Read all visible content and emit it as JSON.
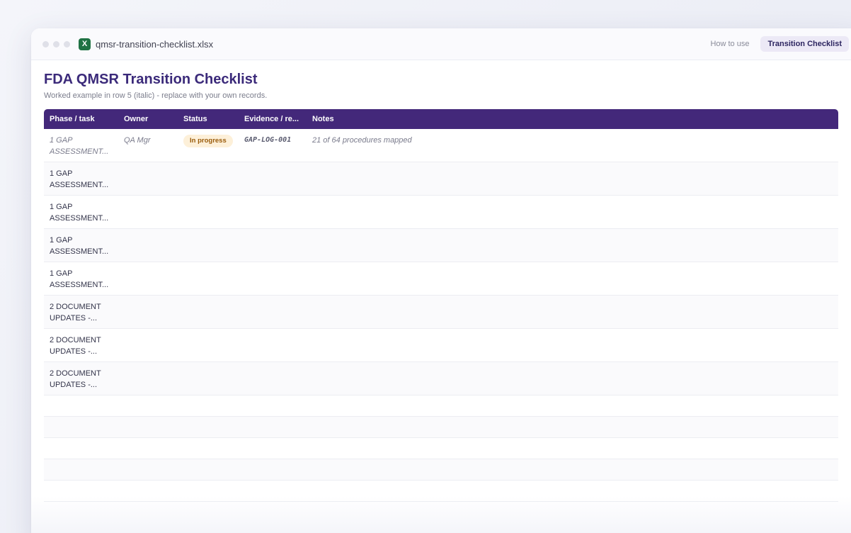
{
  "window": {
    "icon_letter": "X",
    "filename": "qmsr-transition-checklist.xlsx",
    "tabs": [
      {
        "label": "How to use",
        "active": false
      },
      {
        "label": "Transition Checklist",
        "active": true
      }
    ]
  },
  "sheet": {
    "title": "FDA QMSR Transition Checklist",
    "subtitle": "Worked example in row 5 (italic) - replace with your own records.",
    "columns": [
      "Phase / task",
      "Owner",
      "Status",
      "Evidence / re...",
      "Notes"
    ],
    "rows": [
      {
        "phase": "1 GAP ASSESSMENT...",
        "owner": "QA Mgr",
        "status": "In progress",
        "evidence": "GAP-LOG-001",
        "notes": "21 of 64 procedures mapped",
        "example": true
      },
      {
        "phase": "1 GAP ASSESSMENT...",
        "owner": "",
        "status": "",
        "evidence": "",
        "notes": ""
      },
      {
        "phase": "1 GAP ASSESSMENT...",
        "owner": "",
        "status": "",
        "evidence": "",
        "notes": ""
      },
      {
        "phase": "1 GAP ASSESSMENT...",
        "owner": "",
        "status": "",
        "evidence": "",
        "notes": ""
      },
      {
        "phase": "1 GAP ASSESSMENT...",
        "owner": "",
        "status": "",
        "evidence": "",
        "notes": ""
      },
      {
        "phase": "2 DOCUMENT UPDATES -...",
        "owner": "",
        "status": "",
        "evidence": "",
        "notes": ""
      },
      {
        "phase": "2 DOCUMENT UPDATES -...",
        "owner": "",
        "status": "",
        "evidence": "",
        "notes": ""
      },
      {
        "phase": "2 DOCUMENT UPDATES -...",
        "owner": "",
        "status": "",
        "evidence": "",
        "notes": ""
      }
    ]
  },
  "colors": {
    "header_bg": "#43287a",
    "title": "#3b2a7a",
    "badge_bg": "#fdf0d9",
    "badge_text": "#9a5c0c",
    "excel_green": "#1f7244"
  }
}
